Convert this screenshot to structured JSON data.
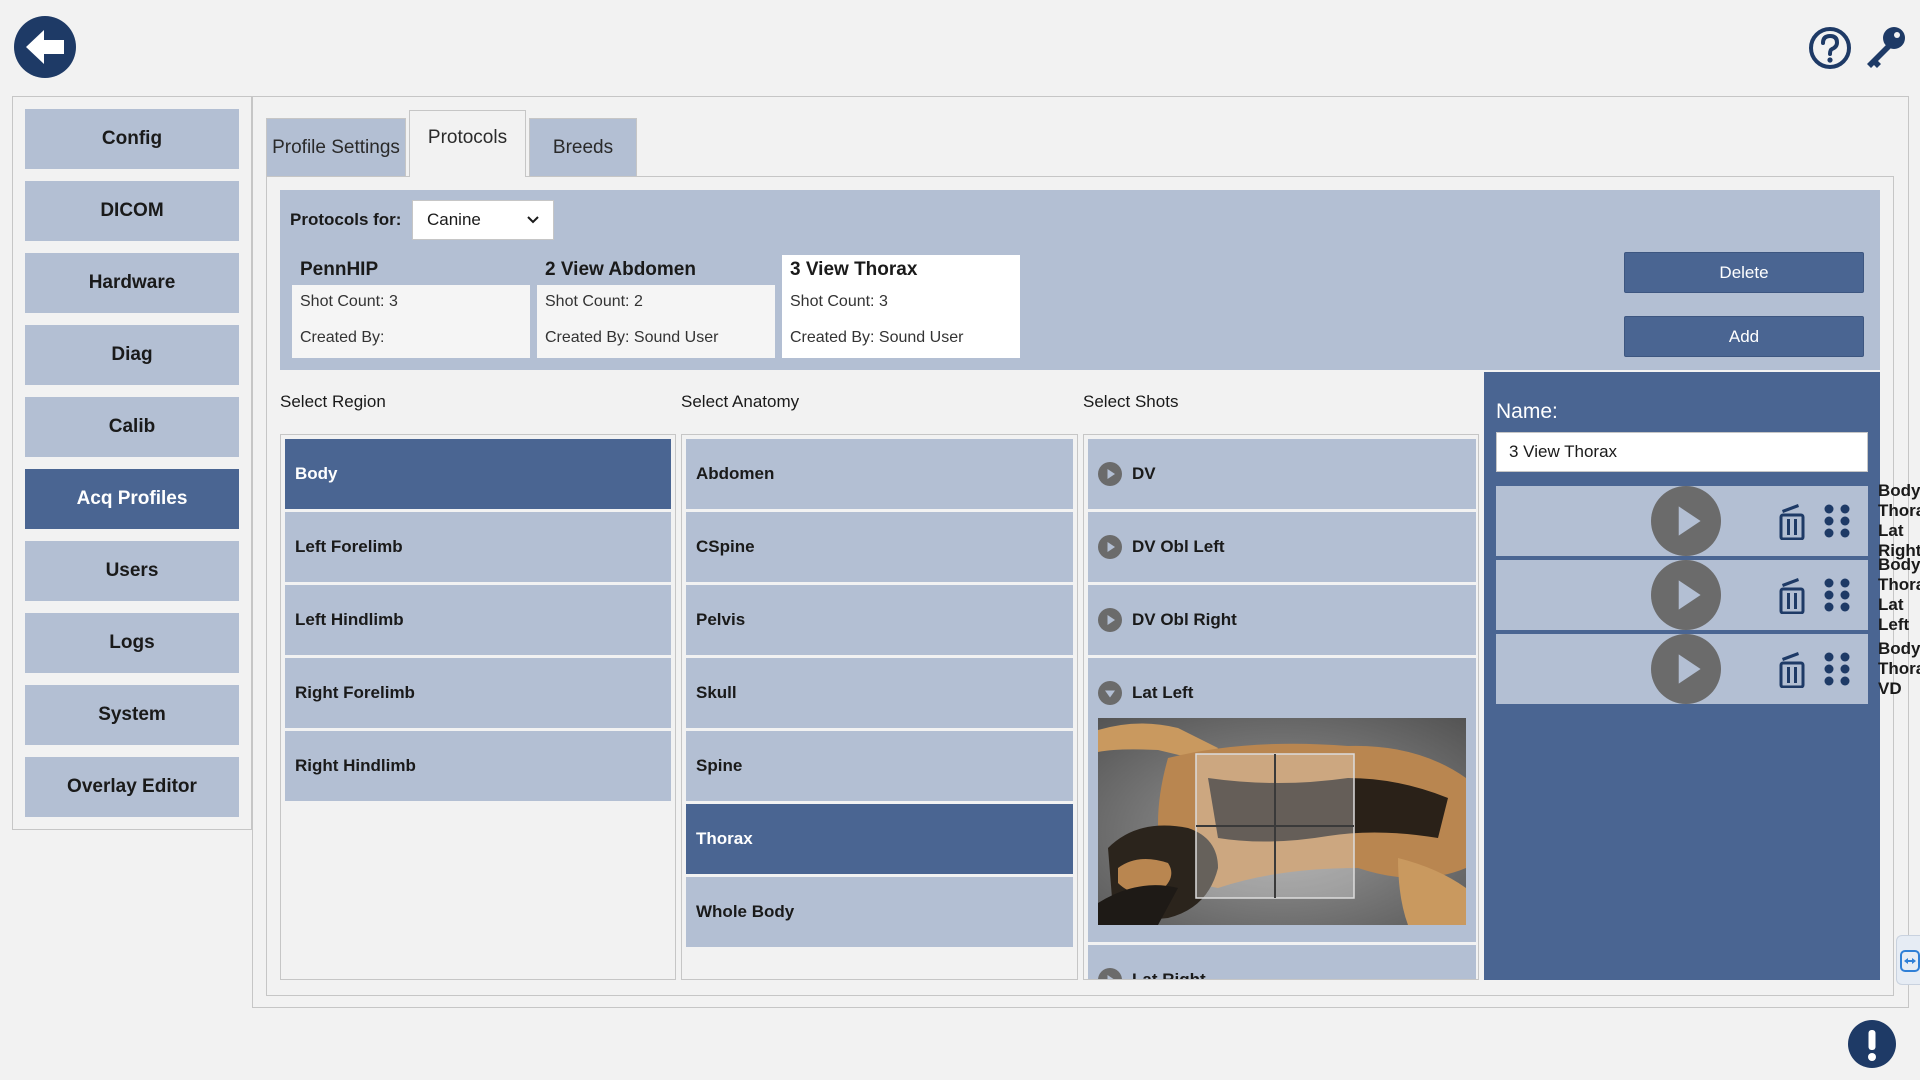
{
  "nav": {
    "items": [
      {
        "label": "Config"
      },
      {
        "label": "DICOM"
      },
      {
        "label": "Hardware"
      },
      {
        "label": "Diag"
      },
      {
        "label": "Calib"
      },
      {
        "label": "Acq Profiles",
        "active": true
      },
      {
        "label": "Users"
      },
      {
        "label": "Logs"
      },
      {
        "label": "System"
      },
      {
        "label": "Overlay Editor"
      }
    ]
  },
  "tabs": [
    {
      "label": "Profile Settings"
    },
    {
      "label": "Protocols",
      "active": true
    },
    {
      "label": "Breeds"
    }
  ],
  "protocols": {
    "for_label": "Protocols for:",
    "species_selected": "Canine",
    "cards": [
      {
        "name": "PennHIP",
        "shot_count": "Shot Count: 3",
        "created_by": "Created By:"
      },
      {
        "name": "2 View Abdomen",
        "shot_count": "Shot Count: 2",
        "created_by": "Created By: Sound User"
      },
      {
        "name": "3 View Thorax",
        "shot_count": "Shot Count: 3",
        "created_by": "Created By: Sound User",
        "selected": true
      }
    ],
    "delete_label": "Delete",
    "add_label": "Add"
  },
  "region": {
    "title": "Select Region",
    "items": [
      "Body",
      "Left Forelimb",
      "Left Hindlimb",
      "Right Forelimb",
      "Right Hindlimb"
    ],
    "selected": "Body"
  },
  "anatomy": {
    "title": "Select Anatomy",
    "items": [
      "Abdomen",
      "CSpine",
      "Pelvis",
      "Skull",
      "Spine",
      "Thorax",
      "Whole Body"
    ],
    "selected": "Thorax"
  },
  "shots": {
    "title": "Select Shots",
    "items": [
      {
        "label": "DV",
        "expanded": false
      },
      {
        "label": "DV Obl Left",
        "expanded": false
      },
      {
        "label": "DV Obl Right",
        "expanded": false
      },
      {
        "label": "Lat Left",
        "expanded": true
      },
      {
        "label": "Lat Right",
        "expanded": false
      }
    ]
  },
  "editor": {
    "name_label": "Name:",
    "name_value": "3 View Thorax",
    "selected_shots": [
      "Body Thorax Lat Right",
      "Body Thorax Lat Left",
      "Body Thorax VD"
    ]
  },
  "icons": {
    "back": "back-arrow-icon",
    "help": "help-icon",
    "key": "key-icon",
    "alert": "alert-icon",
    "trash": "trash-icon",
    "drag": "drag-handle-icon",
    "expand": "play-icon",
    "collapse": "chevron-down-icon",
    "remote": "remote-support-icon"
  },
  "colors": {
    "primary_dark": "#1e3a66",
    "accent": "#4a6592",
    "item_bg": "#b3bfd3",
    "page_bg": "#f2f2f2"
  }
}
